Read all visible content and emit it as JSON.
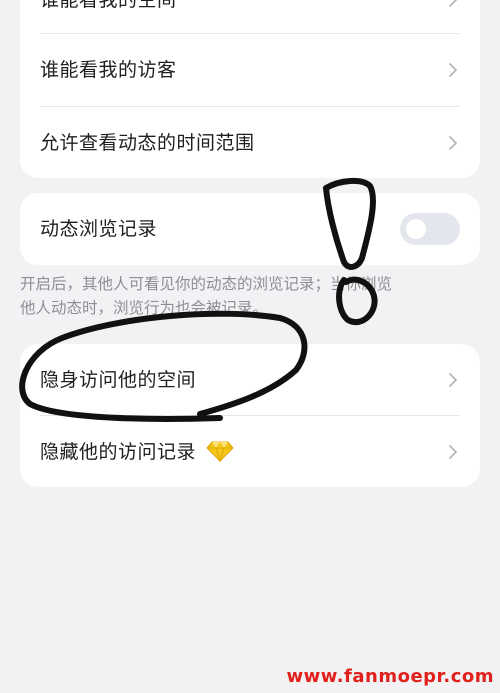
{
  "privacy_card": {
    "items": [
      {
        "label": "谁能看我的空间"
      },
      {
        "label": "谁能看我的访客"
      },
      {
        "label": "允许查看动态的时间范围"
      }
    ]
  },
  "browse_record": {
    "label": "动态浏览记录",
    "toggle_on": false,
    "description": "开启后，其他人可看见你的动态的浏览记录；当你浏览\n他人动态时，浏览行为也会被记录。"
  },
  "visit_card": {
    "items": [
      {
        "label": "隐身访问他的空间"
      },
      {
        "label": "隐藏他的访问记录",
        "badge_icon": "diamond-vip-icon"
      }
    ]
  },
  "colors": {
    "background": "#f2f2f4",
    "card": "#ffffff",
    "toggle_off": "#e3e6ec",
    "chevron": "#b6b6bb",
    "annotation_ink": "#111111",
    "watermark": "#e0201a",
    "gem": "#f5c518"
  },
  "watermark": "www.fanmoepr.com"
}
